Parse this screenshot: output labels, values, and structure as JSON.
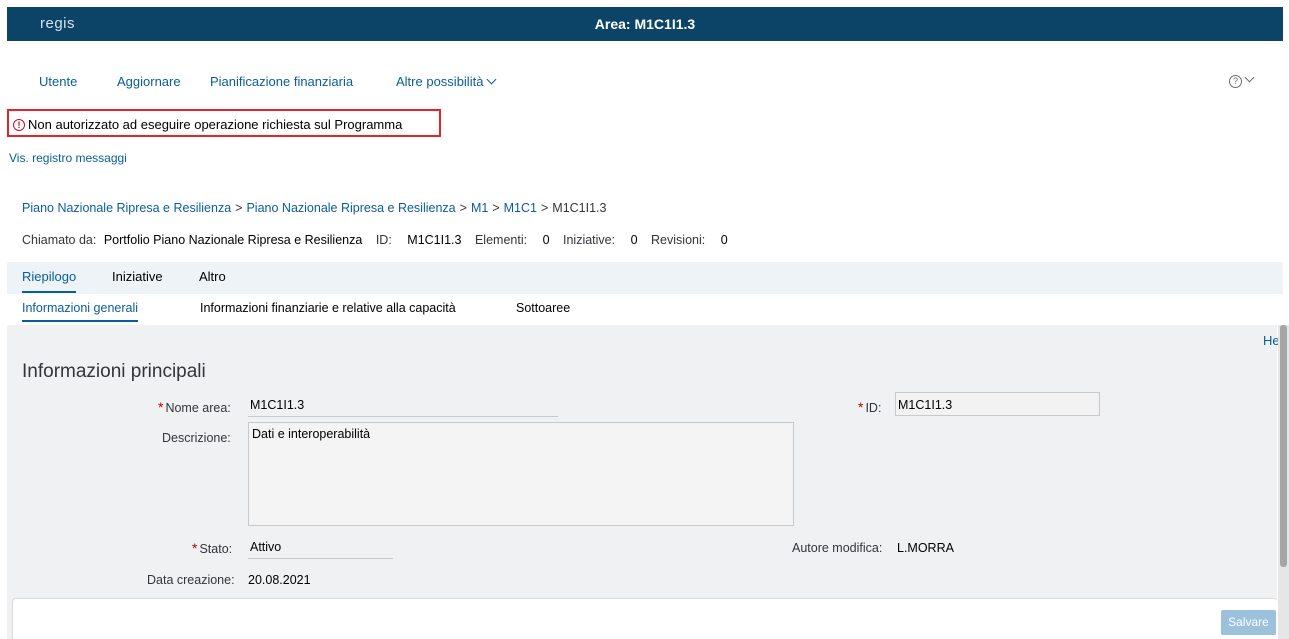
{
  "shell": {
    "logo": "regis",
    "title": "Area: M1C1I1.3"
  },
  "menu": {
    "items": [
      "Utente",
      "Aggiornare",
      "Pianificazione finanziaria",
      "Altre possibilità"
    ],
    "help": "?"
  },
  "error": {
    "icon": "!",
    "text": "Non autorizzato ad eseguire operazione richiesta sul Programma"
  },
  "log_link": "Vis. registro messaggi",
  "breadcrumb": {
    "links": [
      "Piano Nazionale Ripresa e Resilienza",
      "Piano Nazionale Ripresa e Resilienza",
      "M1",
      "M1C1"
    ],
    "current": "M1C1I1.3",
    "separator": ">"
  },
  "called_by": {
    "label": "Chiamato da:",
    "value": "Portfolio Piano Nazionale Ripresa e Resilienza",
    "id_label": "ID:",
    "id_value": "M1C1I1.3",
    "elementi_label": "Elementi:",
    "elementi_value": "0",
    "iniziative_label": "Iniziative:",
    "iniziative_value": "0",
    "revisioni_label": "Revisioni:",
    "revisioni_value": "0"
  },
  "tabs_primary": [
    "Riepilogo",
    "Iniziative",
    "Altro"
  ],
  "tabs_secondary": [
    "Informazioni generali",
    "Informazioni finanziarie e relative alla capacità",
    "Sottoaree"
  ],
  "help_link": "Help",
  "section_title": "Informazioni principali",
  "form": {
    "required_mark": "*",
    "nome_area_label": "Nome area:",
    "nome_area_value": "M1C1I1.3",
    "id_label": "ID:",
    "id_value": "M1C1I1.3",
    "descrizione_label": "Descrizione:",
    "descrizione_value": "Dati e interoperabilità",
    "stato_label": "Stato:",
    "stato_value": "Attivo",
    "autore_label": "Autore modifica:",
    "autore_value": "L.MORRA",
    "data_label": "Data creazione:",
    "data_value": "20.08.2021"
  },
  "footer": {
    "save_label": "Salvare"
  },
  "colors": {
    "shell_bg": "#0b4467",
    "link": "#0a5d99",
    "error_border": "#e2242b",
    "save_bg": "#9cc1dc"
  }
}
